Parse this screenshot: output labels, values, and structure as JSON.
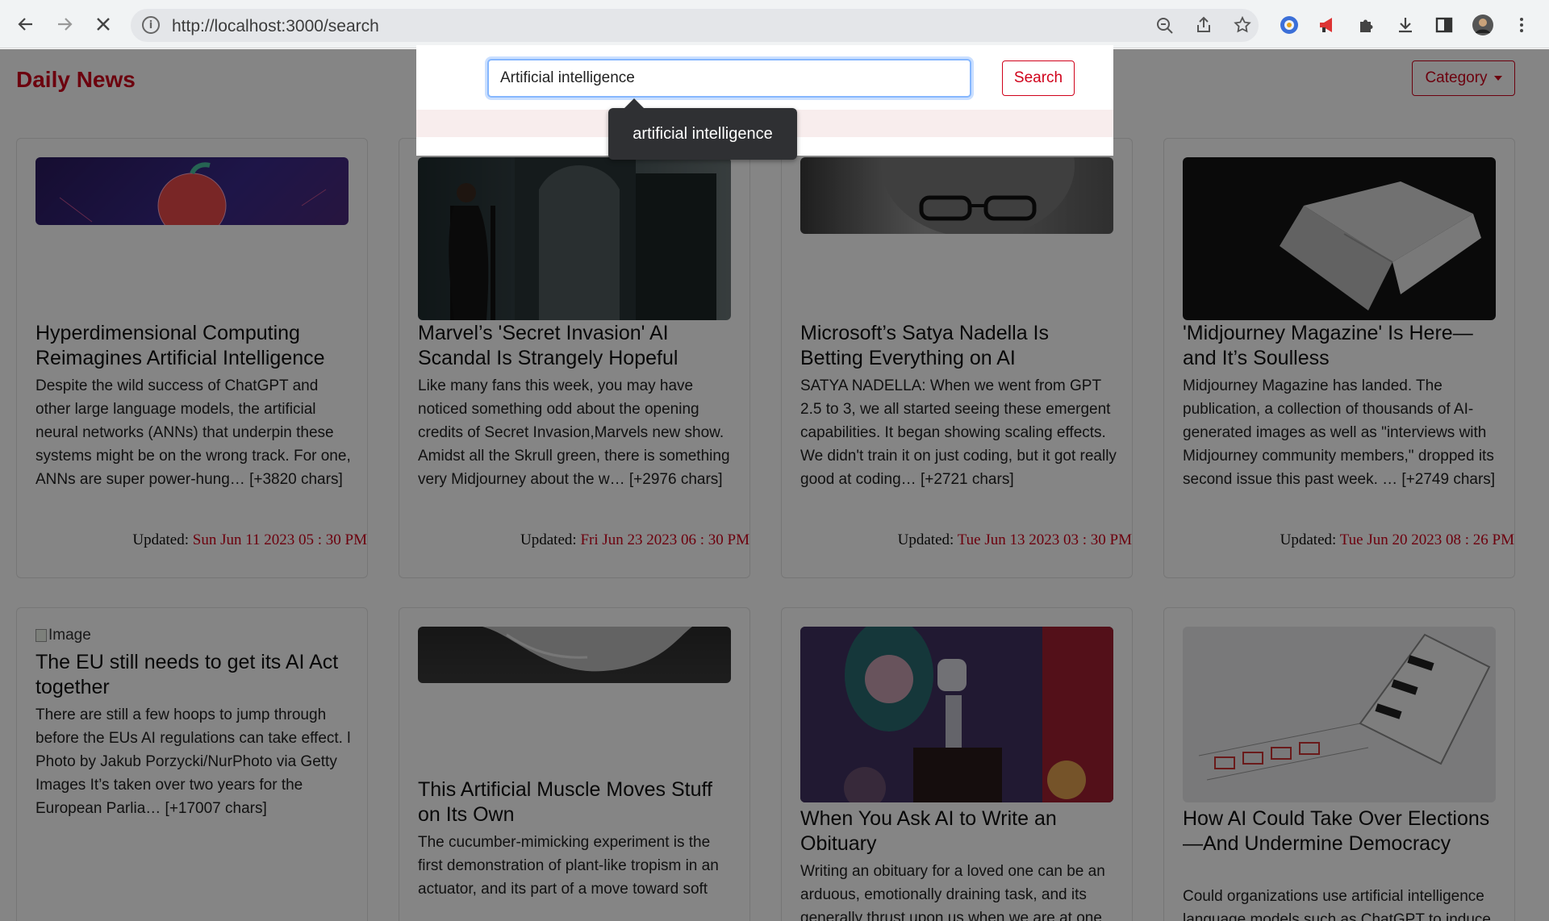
{
  "browser": {
    "url": "http://localhost:3000/search",
    "back_icon": "arrow-left-icon",
    "forward_icon": "arrow-right-icon",
    "stop_icon": "close-icon"
  },
  "navbar": {
    "brand": "Daily News",
    "category_label": "Category"
  },
  "search": {
    "value": "Artificial intelligence",
    "button_label": "Search",
    "suggestion": "artificial intelligence"
  },
  "cards": [
    {
      "title": "Hyperdimensional Computing Reimagines Artificial Intelligence",
      "description": "Despite the wild success of ChatGPT and other large language models, the artificial neural networks (ANNs) that underpin these systems might be on the wrong track. For one, ANNs are super power-hung… [+3820 chars]",
      "updated_label": "Updated:",
      "updated": "Sun Jun 11 2023 05 : 30 PM"
    },
    {
      "title": "Marvel’s 'Secret Invasion' AI Scandal Is Strangely Hopeful",
      "description": "Like many fans this week, you may have noticed something odd about the opening credits of Secret Invasion,Marvels new show. Amidst all the Skrull green, there is something very Midjourney about the w… [+2976 chars]",
      "updated_label": "Updated:",
      "updated": "Fri Jun 23 2023 06 : 30 PM"
    },
    {
      "title": "Microsoft’s Satya Nadella Is Betting Everything on AI",
      "description": "SATYA NADELLA: When we went from GPT 2.5 to 3, we all started seeing these emergent capabilities. It began showing scaling effects. We didn't train it on just coding, but it got really good at coding… [+2721 chars]",
      "updated_label": "Updated:",
      "updated": "Tue Jun 13 2023 03 : 30 PM"
    },
    {
      "title": "'Midjourney Magazine' Is Here—and It’s Soulless",
      "description": "Midjourney Magazine has landed. The publication, a collection of thousands of AI-generated images as well as \"interviews with Midjourney community members,\" dropped its second issue this past week. … [+2749 chars]",
      "updated_label": "Updated:",
      "updated": "Tue Jun 20 2023 08 : 26 PM"
    },
    {
      "image_alt": "Image",
      "title": "The EU still needs to get its AI Act together",
      "description": "There are still a few hoops to jump through before the EUs AI regulations can take effect. l Photo by Jakub Porzycki/NurPhoto via Getty Images It’s taken over two years for the European Parlia… [+17007 chars]"
    },
    {
      "title": "This Artificial Muscle Moves Stuff on Its Own",
      "description": "The cucumber-mimicking experiment is the first demonstration of plant-like tropism in an actuator, and its part of a move toward soft"
    },
    {
      "title": "When You Ask AI to Write an Obituary",
      "description": "Writing an obituary for a loved one can be an arduous, emotionally draining task, and its generally thrust upon us when we are at one"
    },
    {
      "title": "How AI Could Take Over Elections—And Undermine Democracy",
      "description": "Could organizations use artificial intelligence language models such as ChatGPT to induce"
    }
  ]
}
